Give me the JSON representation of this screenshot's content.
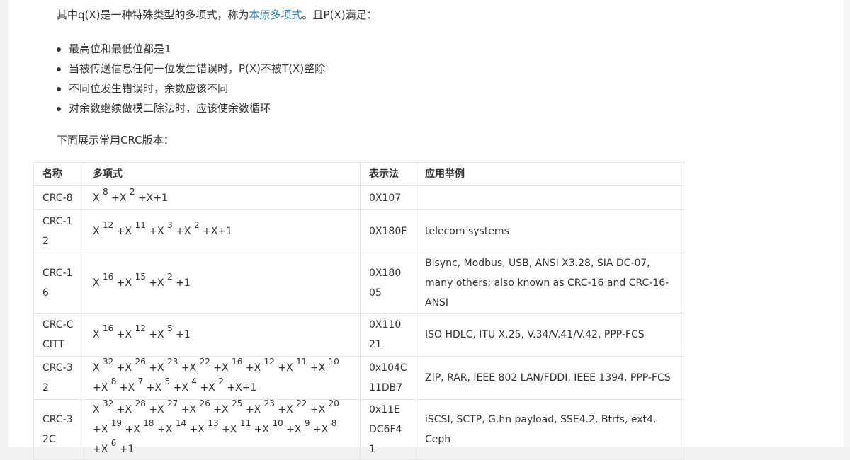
{
  "intro": {
    "before_link": "其中q(X)是一种特殊类型的多项式，称为",
    "link": "本原多项式",
    "after_link": "。且P(X)满足："
  },
  "bullets": [
    "最高位和最低位都是1",
    "当被传送信息任何一位发生错误时，P(X)不被T(X)整除",
    "不同位发生错误时，余数应该不同",
    "对余数继续做模二除法时，应该使余数循环"
  ],
  "table_intro": "下面展示常用CRC版本：",
  "table": {
    "headers": [
      "名称",
      "多项式",
      "表示法",
      "应用举例"
    ],
    "rows": [
      {
        "name": "CRC-8",
        "terms": [
          {
            "t": "X",
            "e": "8"
          },
          {
            "t": "+X",
            "e": "2"
          },
          {
            "t": "+X+1",
            "e": ""
          }
        ],
        "repr": "0X107",
        "use": ""
      },
      {
        "name": "CRC-12",
        "terms": [
          {
            "t": "X",
            "e": "12"
          },
          {
            "t": "+X",
            "e": "11"
          },
          {
            "t": "+X",
            "e": "3"
          },
          {
            "t": "+X",
            "e": "2"
          },
          {
            "t": "+X+1",
            "e": ""
          }
        ],
        "repr": "0X180F",
        "use": "telecom systems"
      },
      {
        "name": "CRC-16",
        "terms": [
          {
            "t": "X",
            "e": "16"
          },
          {
            "t": "+X",
            "e": "15"
          },
          {
            "t": "+X",
            "e": "2"
          },
          {
            "t": "+1",
            "e": ""
          }
        ],
        "repr": "0X18005",
        "use": "Bisync, Modbus, USB, ANSI X3.28, SIA DC-07, many others; also known as CRC-16 and CRC-16-ANSI"
      },
      {
        "name": "CRC-CCITT",
        "terms": [
          {
            "t": "X",
            "e": "16"
          },
          {
            "t": "+X",
            "e": "12"
          },
          {
            "t": "+X",
            "e": "5"
          },
          {
            "t": "+1",
            "e": ""
          }
        ],
        "repr": "0X11021",
        "use": "ISO HDLC, ITU X.25, V.34/V.41/V.42, PPP-FCS"
      },
      {
        "name": "CRC-32",
        "terms": [
          {
            "t": "X",
            "e": "32"
          },
          {
            "t": "+X",
            "e": "26"
          },
          {
            "t": "+X",
            "e": "23"
          },
          {
            "t": "+X",
            "e": "22"
          },
          {
            "t": "+X",
            "e": "16"
          },
          {
            "t": "+X",
            "e": "12"
          },
          {
            "t": "+X",
            "e": "11"
          },
          {
            "t": "+X",
            "e": "10"
          },
          {
            "t": "+X",
            "e": "8"
          },
          {
            "t": "+X",
            "e": "7"
          },
          {
            "t": "+X",
            "e": "5"
          },
          {
            "t": "+X",
            "e": "4"
          },
          {
            "t": "+X",
            "e": "2"
          },
          {
            "t": "+X+1",
            "e": ""
          }
        ],
        "repr": "0x104C11DB7",
        "use": "ZIP, RAR, IEEE 802 LAN/FDDI, IEEE 1394, PPP-FCS"
      },
      {
        "name": "CRC-32C",
        "terms": [
          {
            "t": "X",
            "e": "32"
          },
          {
            "t": "+X",
            "e": "28"
          },
          {
            "t": "+X",
            "e": "27"
          },
          {
            "t": "+X",
            "e": "26"
          },
          {
            "t": "+X",
            "e": "25"
          },
          {
            "t": "+X",
            "e": "23"
          },
          {
            "t": "+X",
            "e": "22"
          },
          {
            "t": "+X",
            "e": "20"
          },
          {
            "t": "+X",
            "e": "19"
          },
          {
            "t": "+X",
            "e": "18"
          },
          {
            "t": "+X",
            "e": "14"
          },
          {
            "t": "+X",
            "e": "13"
          },
          {
            "t": "+X",
            "e": "11"
          },
          {
            "t": "+X",
            "e": "10"
          },
          {
            "t": "+X",
            "e": "9"
          },
          {
            "t": "+X",
            "e": "8"
          },
          {
            "t": "+X",
            "e": "6"
          },
          {
            "t": "+1",
            "e": ""
          }
        ],
        "repr": "0x11EDC6F41",
        "use": "iSCSI, SCTP, G.hn payload, SSE4.2, Btrfs, ext4, Ceph"
      }
    ]
  },
  "colors": {
    "link": "#2f7fc3",
    "text": "#333333",
    "border": "#e5e5e5",
    "background": "#ffffff"
  }
}
